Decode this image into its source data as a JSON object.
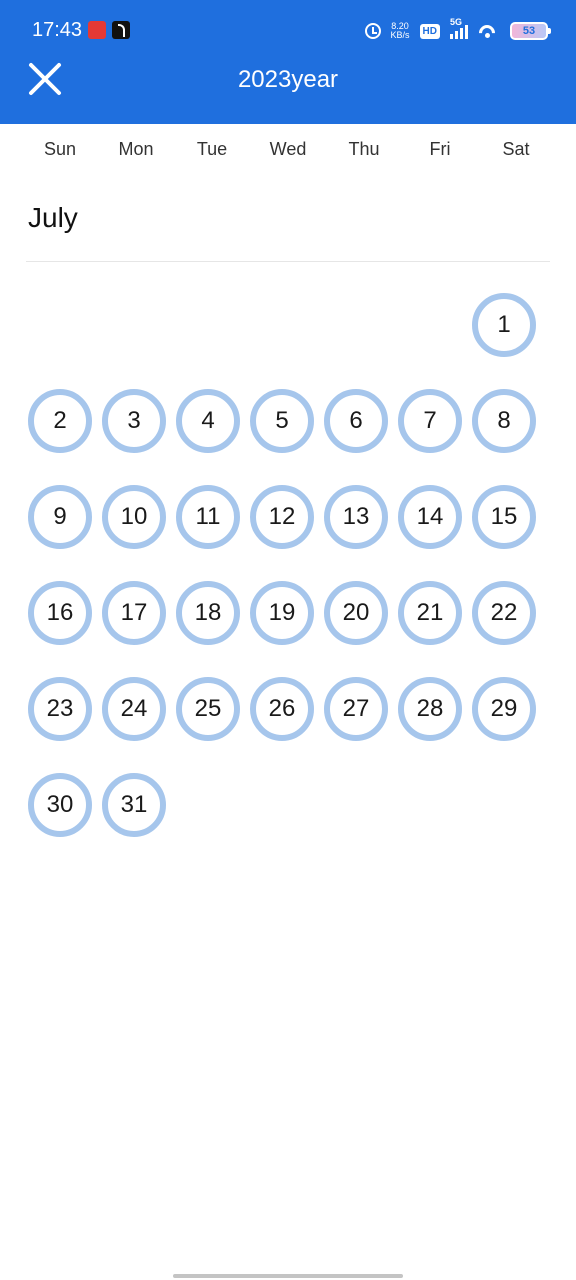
{
  "status_bar": {
    "time": "17:43",
    "net_speed_value": "8.20",
    "net_speed_unit": "KB/s",
    "hd_label": "HD",
    "signal_label": "5G",
    "battery_level": "53"
  },
  "header": {
    "title": "2023year",
    "close_icon": "close-icon"
  },
  "weekdays": [
    "Sun",
    "Mon",
    "Tue",
    "Wed",
    "Thu",
    "Fri",
    "Sat"
  ],
  "month": {
    "name": "July",
    "leading_blanks": 6,
    "days": [
      "1",
      "2",
      "3",
      "4",
      "5",
      "6",
      "7",
      "8",
      "9",
      "10",
      "11",
      "12",
      "13",
      "14",
      "15",
      "16",
      "17",
      "18",
      "19",
      "20",
      "21",
      "22",
      "23",
      "24",
      "25",
      "26",
      "27",
      "28",
      "29",
      "30",
      "31"
    ]
  },
  "colors": {
    "header_bg": "#1f6fde",
    "day_ring": "#a6c6ec"
  }
}
